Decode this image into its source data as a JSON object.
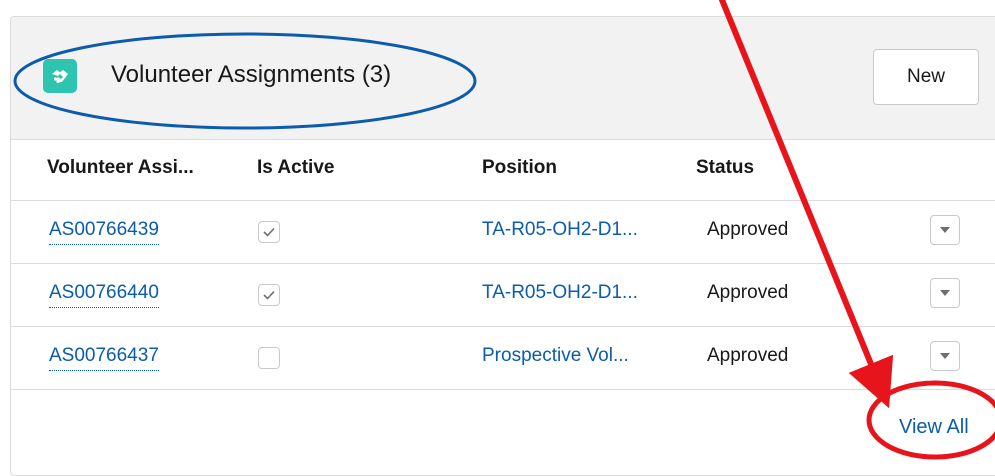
{
  "card": {
    "title": "Volunteer Assignments (3)",
    "icon": "handshake-icon",
    "icon_color": "#2ec5b0",
    "new_button_label": "New"
  },
  "table": {
    "columns": [
      "Volunteer Assi...",
      "Is Active",
      "Position",
      "Status"
    ],
    "rows": [
      {
        "id": "AS00766439",
        "is_active": true,
        "position": "TA-R05-OH2-D1...",
        "status": "Approved"
      },
      {
        "id": "AS00766440",
        "is_active": true,
        "position": "TA-R05-OH2-D1...",
        "status": "Approved"
      },
      {
        "id": "AS00766437",
        "is_active": false,
        "position": "Prospective Vol...",
        "status": "Approved"
      }
    ]
  },
  "footer": {
    "view_all_label": "View All"
  },
  "annotations": {
    "color": "#e8141b"
  }
}
